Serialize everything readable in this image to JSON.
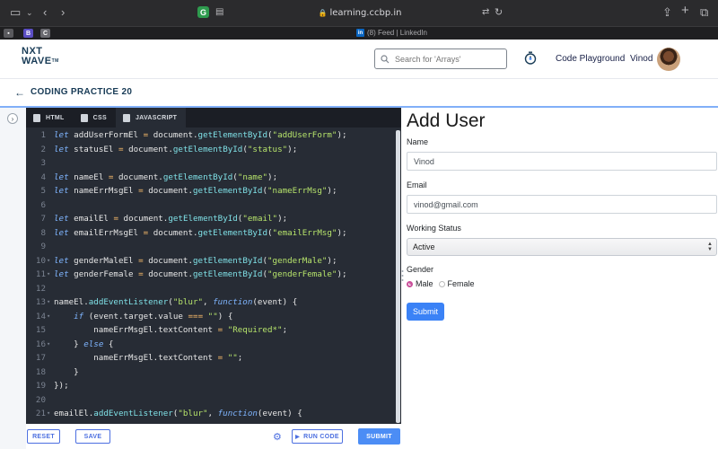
{
  "browser": {
    "url": "learning.ccbp.in",
    "tab_title": "(8) Feed | LinkedIn",
    "linkedin_icon": "in",
    "extension_letter": "G",
    "bookmark_b": "B",
    "bookmark_c": "C"
  },
  "header": {
    "logo_line1": "NXT",
    "logo_line2": "WAVE",
    "logo_tm": "TM",
    "search_placeholder": "Search for 'Arrays'",
    "playground_label": "Code Playground",
    "user_name": "Vinod"
  },
  "practice": {
    "title": "CODING PRACTICE 20"
  },
  "editor": {
    "tabs": [
      {
        "label": "HTML",
        "icon": "html5-icon"
      },
      {
        "label": "CSS",
        "icon": "css3-icon"
      },
      {
        "label": "JAVASCRIPT",
        "icon": "js-file-icon",
        "active": true
      }
    ],
    "line_numbers": [
      "1",
      "2",
      "3",
      "4",
      "5",
      "6",
      "7",
      "8",
      "9",
      "10",
      "11",
      "12",
      "13",
      "14",
      "15",
      "16",
      "17",
      "18",
      "19",
      "20",
      "21"
    ],
    "code_lines": [
      "let addUserFormEl = document.getElementById(\"addUserForm\");",
      "let statusEl = document.getElementById(\"status\");",
      "",
      "let nameEl = document.getElementById(\"name\");",
      "let nameErrMsgEl = document.getElementById(\"nameErrMsg\");",
      "",
      "let emailEl = document.getElementById(\"email\");",
      "let emailErrMsgEl = document.getElementById(\"emailErrMsg\");",
      "",
      "let genderMaleEl = document.getElementById(\"genderMale\");",
      "let genderFemale = document.getElementById(\"genderFemale\");",
      "",
      "nameEl.addEventListener(\"blur\", function(event) {",
      "    if (event.target.value === \"\") {",
      "        nameErrMsgEl.textContent = \"Required*\";",
      "    } else {",
      "        nameErrMsgEl.textContent = \"\";",
      "    }",
      "});",
      "",
      "emailEl.addEventListener(\"blur\", function(event) {"
    ],
    "footer": {
      "reset_label": "RESET",
      "save_label": "SAVE",
      "run_label": "RUN CODE",
      "submit_label": "SUBMIT"
    }
  },
  "output": {
    "title": "Add User",
    "name_label": "Name",
    "name_value": "Vinod",
    "email_label": "Email",
    "email_value": "vinod@gmail.com",
    "status_label": "Working Status",
    "status_value": "Active",
    "gender_label": "Gender",
    "gender_male": "Male",
    "gender_female": "Female",
    "submit_label": "Submit"
  },
  "colors": {
    "brand": "#183b56",
    "accent": "#4c8df5",
    "editor_bg": "#272c35"
  }
}
